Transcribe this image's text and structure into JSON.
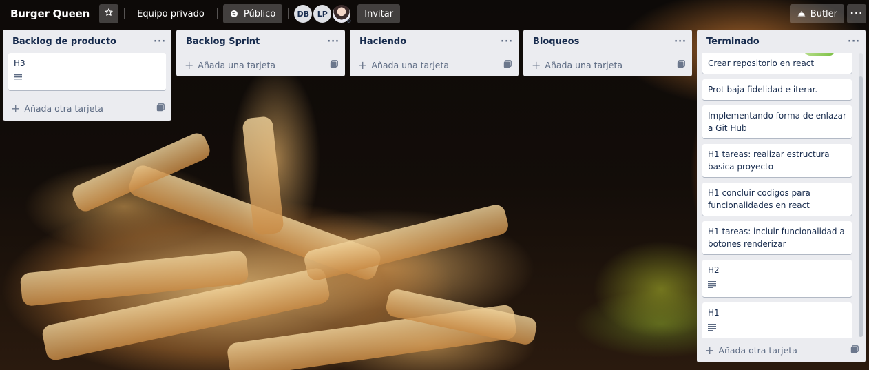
{
  "header": {
    "board_title": "Burger Queen",
    "star_icon": "star-icon",
    "team_label": "Equipo privado",
    "visibility_label": "Público",
    "members": [
      {
        "initials": "DB"
      },
      {
        "initials": "LP"
      },
      {
        "initials": ""
      }
    ],
    "invite_label": "Invitar",
    "butler_label": "Butler",
    "more_label": "···"
  },
  "lists": [
    {
      "title": "Backlog de producto",
      "menu": "···",
      "cards": [
        {
          "text": "H3",
          "has_description": true
        }
      ],
      "add_label": "Añada otra tarjeta"
    },
    {
      "title": "Backlog Sprint",
      "menu": "···",
      "cards": [],
      "add_label": "Añada una tarjeta"
    },
    {
      "title": "Haciendo",
      "menu": "···",
      "cards": [],
      "add_label": "Añada una tarjeta"
    },
    {
      "title": "Bloqueos",
      "menu": "···",
      "cards": [],
      "add_label": "Añada una tarjeta"
    },
    {
      "title": "Terminado",
      "menu": "···",
      "cards": [
        {
          "text": "Crear repositorio en react",
          "has_description": false
        },
        {
          "text": "Prot baja fidelidad e iterar.",
          "has_description": false
        },
        {
          "text": "Implementando forma de enlazar a Git Hub",
          "has_description": false
        },
        {
          "text": "H1 tareas: realizar estructura basica proyecto",
          "has_description": false
        },
        {
          "text": "H1 concluir codigos para funcionalidades en react",
          "has_description": false
        },
        {
          "text": "H1 tareas: incluir funcionalidad a botones renderizar",
          "has_description": false
        },
        {
          "text": "H2",
          "has_description": true
        },
        {
          "text": "H1",
          "has_description": true
        }
      ],
      "add_label": "Añada otra tarjeta"
    }
  ],
  "colors": {
    "list_bg": "#ebecf0",
    "card_bg": "#ffffff",
    "text": "#172b4d",
    "muted": "#5e6c84"
  }
}
